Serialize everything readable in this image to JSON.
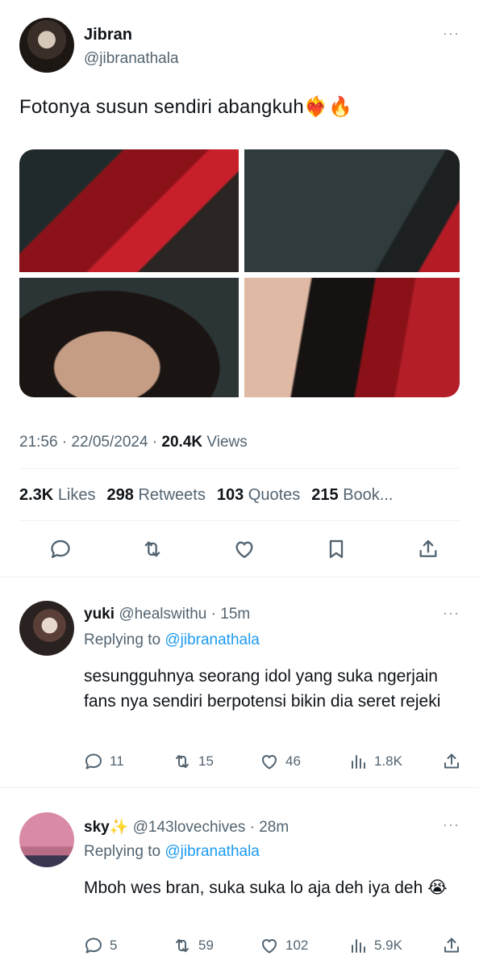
{
  "tweet": {
    "author_name": "Jibran",
    "author_handle": "@jibranathala",
    "text": "Fotonya susun sendiri abangkuh❤️‍🔥🔥",
    "time": "21:56 · 22/05/2024 · ",
    "views_count": "20.4K",
    "views_label": " Views",
    "more_glyph": "···",
    "stats": {
      "likes_count": "2.3K",
      "likes_label": "Likes",
      "retweets_count": "298",
      "retweets_label": "Retweets",
      "quotes_count": "103",
      "quotes_label": "Quotes",
      "bookmarks_count": "215",
      "bookmarks_label": "Book..."
    }
  },
  "replies": [
    {
      "name": "yuki",
      "handle": "@healswithu",
      "time": "15m",
      "replying_prefix": "Replying to ",
      "replying_to": "@jibranathala",
      "text": "sesungguhnya seorang idol yang suka ngerjain fans nya sendiri berpotensi bikin dia seret rejeki",
      "replies_count": "11",
      "retweets_count": "15",
      "likes_count": "46",
      "views_count": "1.8K"
    },
    {
      "name": "sky✨",
      "handle": "@143lovechives",
      "time": "28m",
      "replying_prefix": "Replying to ",
      "replying_to": "@jibranathala",
      "text": "Mboh wes bran, suka suka lo aja deh iya deh 😭",
      "replies_count": "5",
      "retweets_count": "59",
      "likes_count": "102",
      "views_count": "5.9K"
    }
  ],
  "icons": [
    "more-icon",
    "reply-icon",
    "retweet-icon",
    "like-icon",
    "bookmark-icon",
    "share-icon",
    "views-icon"
  ],
  "colors": {
    "link": "#1d9bf0",
    "secondary_text": "#536471",
    "primary_text": "#0f1419",
    "divider": "#eff3f4"
  }
}
